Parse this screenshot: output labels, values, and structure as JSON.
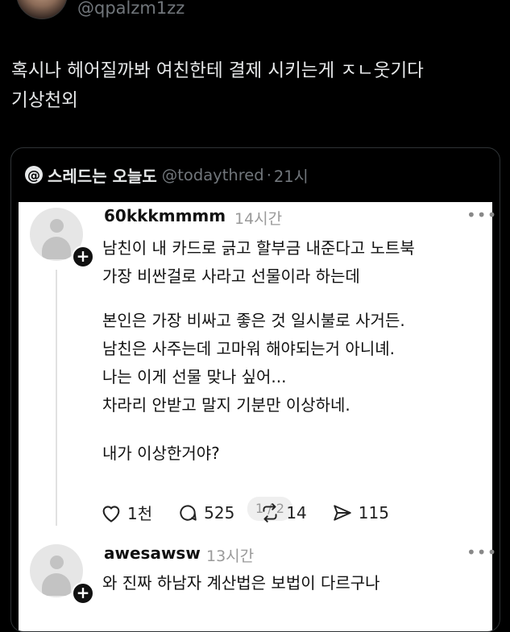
{
  "top_tweet": {
    "handle": "@qpalzm1zz",
    "text": "혹시나 헤어질까봐 여친한테 결제 시키는게 ㅈㄴ웃기다\n기상천외"
  },
  "quote": {
    "author": "스레드는 오늘도",
    "handle": "@todaythred",
    "separator": "·",
    "time": "21시"
  },
  "comments": [
    {
      "username": "60kkkmmmm",
      "time": "14시간",
      "more": "•••",
      "paragraph1": "남친이 내 카드로 긁고 할부금 내준다고 노트북\n가장 비싼걸로 사라고 선물이라 하는데",
      "paragraph2": "본인은 가장 비싸고 좋은 것 일시불로 사거든.\n남친은 사주는데 고마워 해야되는거 아니녜.\n나는 이게 선물 맞나 싶어...\n차라리 안받고 말지 기분만 이상하네.",
      "paragraph3": "내가 이상한거야?",
      "page": "1 / 2",
      "likes": "1천",
      "replies": "525",
      "reposts": "14",
      "shares": "115"
    },
    {
      "username": "awesawsw",
      "time": "13시간",
      "more": "•••",
      "text": "와 진짜 하남자 계산법은 보법이 다르구나"
    }
  ]
}
